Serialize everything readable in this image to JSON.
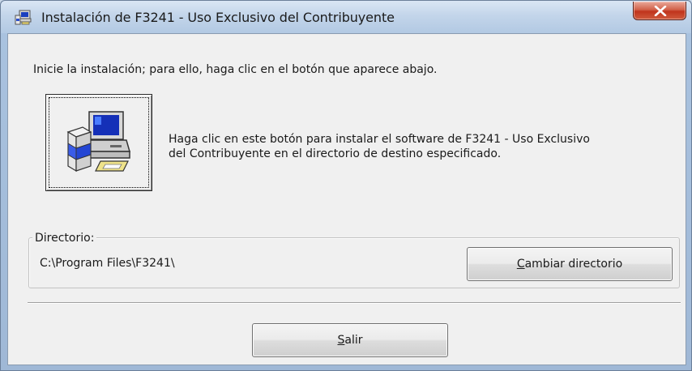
{
  "window": {
    "title": "Instalación de F3241 - Uso Exclusivo del Contribuyente",
    "app_icon": "installer-computer-icon",
    "close_icon": "close-x-icon"
  },
  "content": {
    "instruction": "Inicie la instalación; para ello, haga clic en el botón que aparece abajo.",
    "install_button_icon": "setup-computer-icon",
    "install_description_line1": "Haga clic en este botón para instalar el software de F3241 - Uso Exclusivo",
    "install_description_line2": "del Contribuyente en el directorio de destino especificado."
  },
  "directory": {
    "group_label": "Directorio:",
    "path": "C:\\Program Files\\F3241\\",
    "change_button": {
      "mnemonic": "C",
      "rest": "ambiar directorio"
    }
  },
  "footer": {
    "exit_button": {
      "mnemonic": "S",
      "rest": "alir"
    }
  },
  "colors": {
    "titlebar": "#c3d5ea",
    "close_button": "#c7432a",
    "dialog_background": "#f0f0f0"
  }
}
